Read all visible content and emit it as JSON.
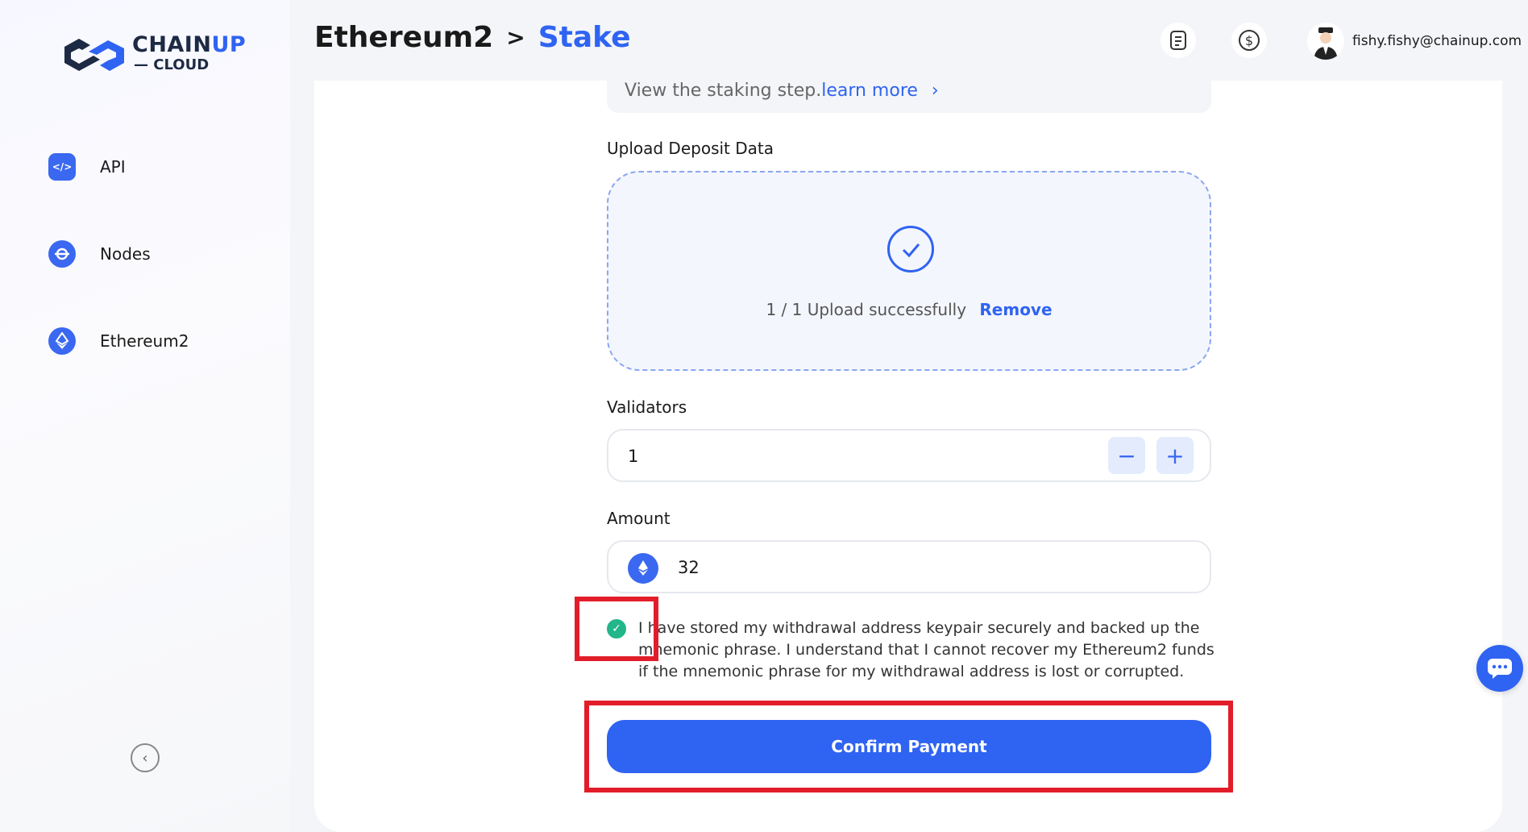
{
  "brand": {
    "name_part1": "CHAIN",
    "name_part2": "UP",
    "subtitle": "— CLOUD"
  },
  "sidebar": {
    "items": [
      {
        "label": "API",
        "icon": "code-icon"
      },
      {
        "label": "Nodes",
        "icon": "nodes-icon"
      },
      {
        "label": "Ethereum2",
        "icon": "ethereum-icon"
      }
    ]
  },
  "header": {
    "breadcrumb_parent": "Ethereum2",
    "breadcrumb_sep": ">",
    "breadcrumb_current": "Stake",
    "user_email": "fishy.fishy@chainup.com"
  },
  "form": {
    "hint_text": "View the staking step.",
    "hint_link": "learn more",
    "upload_label": "Upload Deposit Data",
    "upload_status": "1 / 1 Upload successfully",
    "upload_remove": "Remove",
    "validators_label": "Validators",
    "validators_value": "1",
    "amount_label": "Amount",
    "amount_value": "32",
    "agree_text": "I have stored my withdrawal address keypair securely and backed up the mnemonic phrase. I understand that I cannot recover my Ethereum2 funds if the mnemonic phrase for my withdrawal address is lost or corrupted.",
    "agree_checked": true,
    "confirm_label": "Confirm Payment"
  },
  "colors": {
    "accent": "#2f63f2",
    "check": "#22b68a",
    "highlight": "#e21d2a"
  }
}
